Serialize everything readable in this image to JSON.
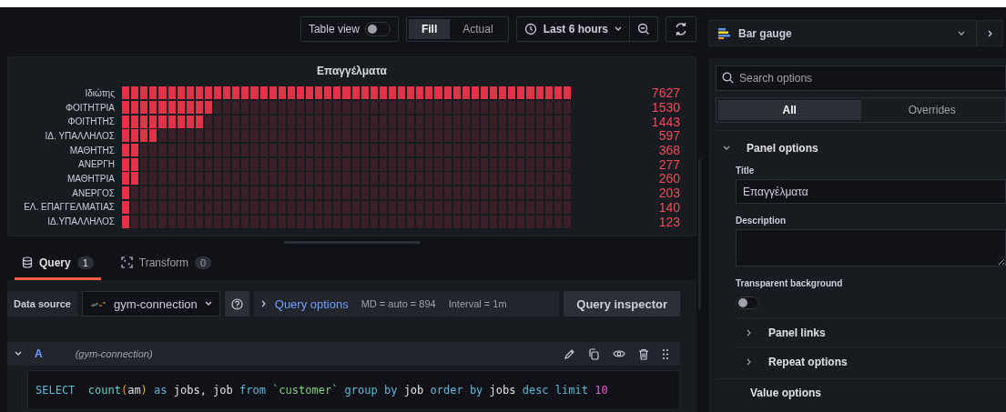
{
  "toolbar": {
    "table_view": {
      "label": "Table view",
      "on": false
    },
    "display_modes": [
      {
        "label": "Fill",
        "selected": true
      },
      {
        "label": "Actual",
        "selected": false
      }
    ],
    "time_range": "Last 6 hours"
  },
  "panel": {
    "title": "Επαγγέλματα",
    "rows": [
      {
        "name": "Ιδιώτης",
        "value": "7627",
        "level": 1
      },
      {
        "name": "ΦΟΙΤΗΤΡΙΑ",
        "value": "1530",
        "level": 0.2006
      },
      {
        "name": "ΦΟΙΤΗΤΗΣ",
        "value": "1443",
        "level": 0.1892
      },
      {
        "name": "ΙΔ. ΥΠΑΛΛΗΛΟΣ",
        "value": "597",
        "level": 0.0783
      },
      {
        "name": "ΜΑΘΗΤΗΣ",
        "value": "368",
        "level": 0.0482
      },
      {
        "name": "ΑΝΕΡΓΗ",
        "value": "277",
        "level": 0.0363
      },
      {
        "name": "ΜΑΘΗΤΡΙΑ",
        "value": "260",
        "level": 0.0341
      },
      {
        "name": "ΑΝΕΡΓΟΣ",
        "value": "203",
        "level": 0.0266
      },
      {
        "name": "ΕΛ. ΕΠΑΓΓΕΛΜΑΤΙΑΣ",
        "value": "140",
        "level": 0.0184
      },
      {
        "name": "ΙΔ.ΥΠΑΛΛΗΛΟΣ",
        "value": "123",
        "level": 0.0161
      }
    ]
  },
  "query_tabs": [
    {
      "label": "Query",
      "count": "1",
      "selected": true
    },
    {
      "label": "Transform",
      "count": "0",
      "selected": false
    }
  ],
  "query_bar": {
    "datasource_label": "Data source",
    "datasource": "gym-connection",
    "options_label": "Query options",
    "md": "MD = auto = 894",
    "interval": "Interval = 1m",
    "inspector": "Query inspector"
  },
  "query": {
    "ref": "A",
    "datasource": "(gym-connection)",
    "expanded": true,
    "tokens": [
      {
        "text": "SELECT  ",
        "kind": "keyword"
      },
      {
        "text": "count",
        "kind": "function"
      },
      {
        "text": "(",
        "kind": "paren"
      },
      {
        "text": "am",
        "kind": "identifier"
      },
      {
        "text": ")",
        "kind": "paren"
      },
      {
        "text": " as ",
        "kind": "keyword"
      },
      {
        "text": "jobs, job ",
        "kind": "identifier"
      },
      {
        "text": "from ",
        "kind": "keyword"
      },
      {
        "text": "`customer`",
        "kind": "string"
      },
      {
        "text": " group by ",
        "kind": "keyword"
      },
      {
        "text": "job ",
        "kind": "identifier"
      },
      {
        "text": "order by ",
        "kind": "keyword"
      },
      {
        "text": "jobs ",
        "kind": "identifier"
      },
      {
        "text": "desc limit ",
        "kind": "keyword"
      },
      {
        "text": "10",
        "kind": "number"
      }
    ]
  },
  "options": {
    "visualization": "Bar gauge",
    "search": {
      "placeholder": "Search options"
    },
    "tabs": [
      {
        "label": "All",
        "selected": true
      },
      {
        "label": "Overrides",
        "selected": false
      }
    ],
    "panel_options": {
      "title": "Panel options",
      "expanded": true,
      "title_label": "Title",
      "title_value": "Επαγγέλματα",
      "description_label": "Description",
      "transparent_label": "Transparent background",
      "transparent_on": false,
      "subsections": [
        {
          "title": "Panel links",
          "expanded": false
        },
        {
          "title": "Repeat options",
          "expanded": false
        }
      ]
    },
    "next_section": "Value options"
  }
}
